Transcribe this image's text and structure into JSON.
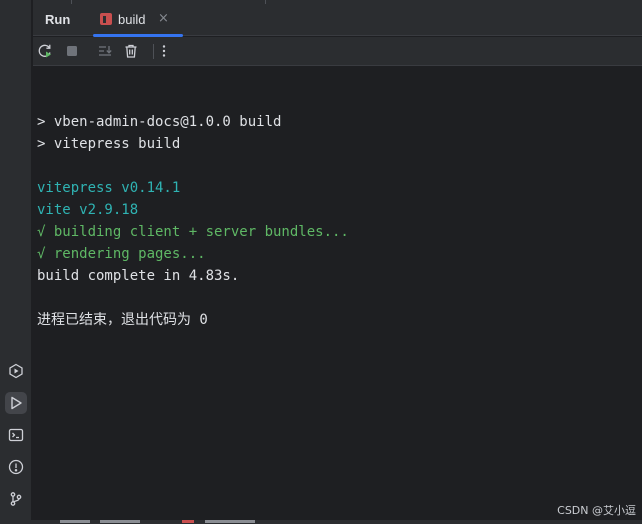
{
  "panel": {
    "title": "Run",
    "tab_label": "build",
    "tab_close": "×"
  },
  "toolbar": {
    "rerun": "rerun-icon",
    "stop": "stop-icon",
    "scroll_to_end": "scroll-to-end-icon",
    "clear": "trash-icon",
    "more": "more-vertical-icon"
  },
  "console": {
    "lines": [
      {
        "text": "",
        "color": "default"
      },
      {
        "text": "> vben-admin-docs@1.0.0 build",
        "color": "default"
      },
      {
        "text": "> vitepress build",
        "color": "default"
      },
      {
        "text": "",
        "color": "default"
      },
      {
        "text": "vitepress v0.14.1",
        "color": "cyan"
      },
      {
        "text": "vite v2.9.18",
        "color": "cyan"
      },
      {
        "text": "√ building client + server bundles...",
        "color": "green"
      },
      {
        "text": "√ rendering pages...",
        "color": "green"
      },
      {
        "text": "build complete in 4.83s.",
        "color": "default"
      },
      {
        "text": "",
        "color": "default"
      },
      {
        "text": "进程已结束，退出代码为 0",
        "color": "default"
      }
    ]
  },
  "left_strip": {
    "items": [
      "services-icon",
      "run-icon",
      "terminal-icon",
      "problems-icon",
      "git-icon"
    ],
    "active": "run-icon"
  },
  "watermark": "CSDN @艾小逗",
  "colors": {
    "background": "#1e1f22",
    "panel": "#2b2d30",
    "accent": "#3574f0",
    "cyan": "#2fb3b3",
    "green": "#5fb865",
    "text": "#dfe1e5"
  }
}
